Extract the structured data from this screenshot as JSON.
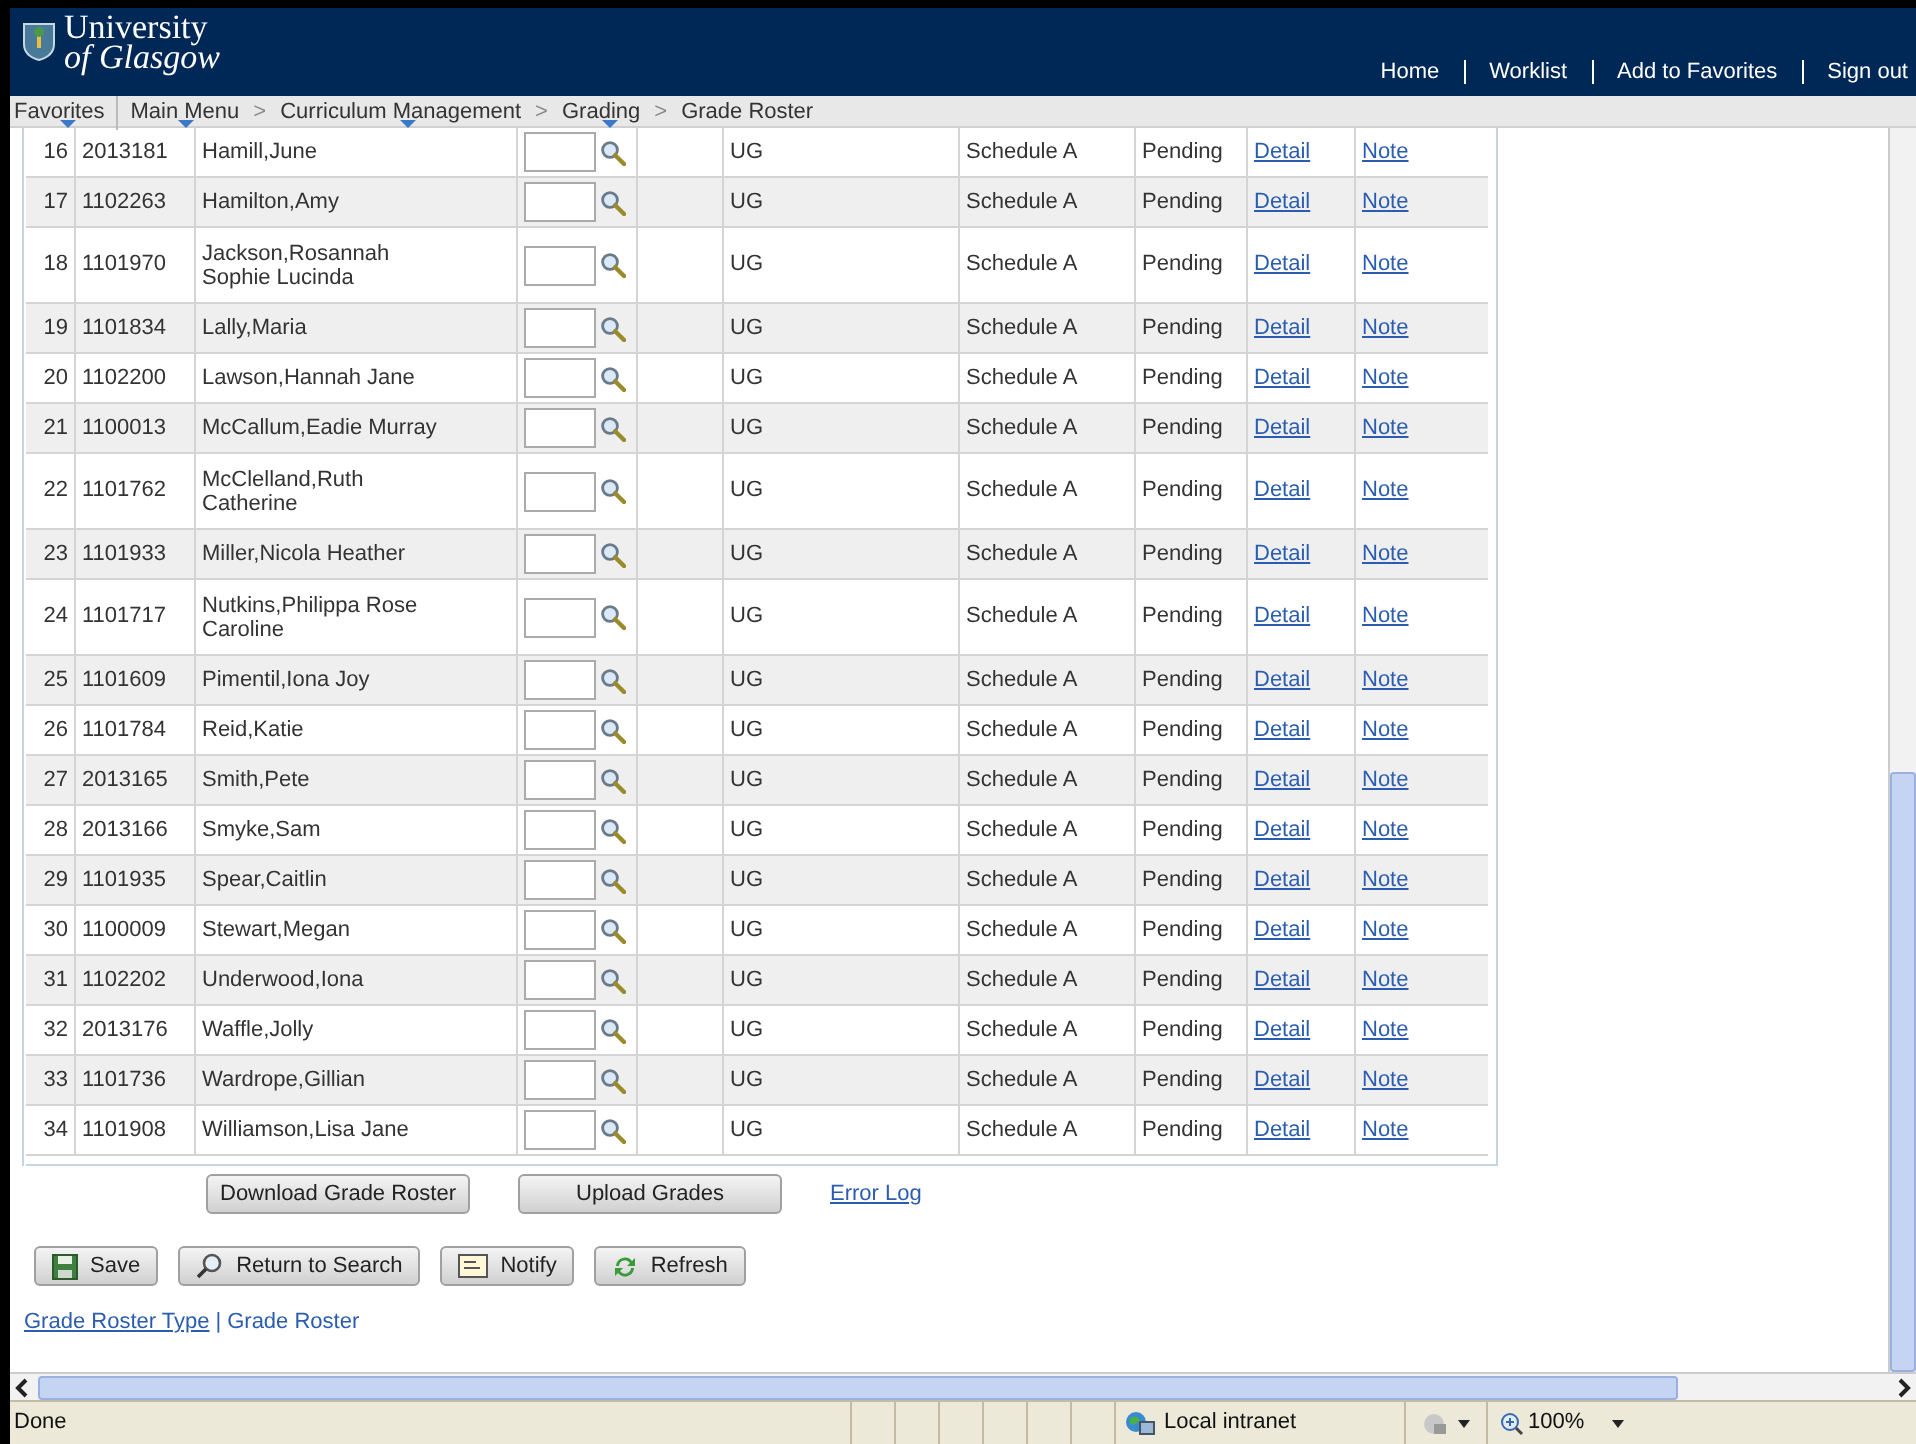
{
  "header": {
    "logo_line1": "University",
    "logo_line2": "of Glasgow",
    "nav": [
      "Home",
      "Worklist",
      "Add to Favorites",
      "Sign out"
    ]
  },
  "breadcrumb": [
    {
      "label": "Favorites",
      "menu": true,
      "kind": "item"
    },
    {
      "label": "Main Menu",
      "menu": true,
      "kind": "item"
    },
    {
      "label": ">",
      "kind": "sep"
    },
    {
      "label": "Curriculum Management",
      "menu": true,
      "kind": "item"
    },
    {
      "label": ">",
      "kind": "sep"
    },
    {
      "label": "Grading",
      "menu": true,
      "kind": "item"
    },
    {
      "label": ">",
      "kind": "sep"
    },
    {
      "label": "Grade Roster",
      "menu": false,
      "kind": "item"
    }
  ],
  "roster": {
    "rows": [
      {
        "num": "16",
        "id": "2013181",
        "name": "Hamill,June",
        "level": "UG",
        "schedule": "Schedule A",
        "status": "Pending",
        "detail": "Detail",
        "note": "Note"
      },
      {
        "num": "17",
        "id": "1102263",
        "name": "Hamilton,Amy",
        "level": "UG",
        "schedule": "Schedule A",
        "status": "Pending",
        "detail": "Detail",
        "note": "Note"
      },
      {
        "num": "18",
        "id": "1101970",
        "name": "Jackson,Rosannah\nSophie Lucinda",
        "level": "UG",
        "schedule": "Schedule A",
        "status": "Pending",
        "detail": "Detail",
        "note": "Note"
      },
      {
        "num": "19",
        "id": "1101834",
        "name": "Lally,Maria",
        "level": "UG",
        "schedule": "Schedule A",
        "status": "Pending",
        "detail": "Detail",
        "note": "Note"
      },
      {
        "num": "20",
        "id": "1102200",
        "name": "Lawson,Hannah Jane",
        "level": "UG",
        "schedule": "Schedule A",
        "status": "Pending",
        "detail": "Detail",
        "note": "Note"
      },
      {
        "num": "21",
        "id": "1100013",
        "name": "McCallum,Eadie Murray",
        "level": "UG",
        "schedule": "Schedule A",
        "status": "Pending",
        "detail": "Detail",
        "note": "Note"
      },
      {
        "num": "22",
        "id": "1101762",
        "name": "McClelland,Ruth\nCatherine",
        "level": "UG",
        "schedule": "Schedule A",
        "status": "Pending",
        "detail": "Detail",
        "note": "Note"
      },
      {
        "num": "23",
        "id": "1101933",
        "name": "Miller,Nicola Heather",
        "level": "UG",
        "schedule": "Schedule A",
        "status": "Pending",
        "detail": "Detail",
        "note": "Note"
      },
      {
        "num": "24",
        "id": "1101717",
        "name": "Nutkins,Philippa Rose\nCaroline",
        "level": "UG",
        "schedule": "Schedule A",
        "status": "Pending",
        "detail": "Detail",
        "note": "Note"
      },
      {
        "num": "25",
        "id": "1101609",
        "name": "Pimentil,Iona Joy",
        "level": "UG",
        "schedule": "Schedule A",
        "status": "Pending",
        "detail": "Detail",
        "note": "Note"
      },
      {
        "num": "26",
        "id": "1101784",
        "name": "Reid,Katie",
        "level": "UG",
        "schedule": "Schedule A",
        "status": "Pending",
        "detail": "Detail",
        "note": "Note"
      },
      {
        "num": "27",
        "id": "2013165",
        "name": "Smith,Pete",
        "level": "UG",
        "schedule": "Schedule A",
        "status": "Pending",
        "detail": "Detail",
        "note": "Note"
      },
      {
        "num": "28",
        "id": "2013166",
        "name": "Smyke,Sam",
        "level": "UG",
        "schedule": "Schedule A",
        "status": "Pending",
        "detail": "Detail",
        "note": "Note"
      },
      {
        "num": "29",
        "id": "1101935",
        "name": "Spear,Caitlin",
        "level": "UG",
        "schedule": "Schedule A",
        "status": "Pending",
        "detail": "Detail",
        "note": "Note"
      },
      {
        "num": "30",
        "id": "1100009",
        "name": "Stewart,Megan",
        "level": "UG",
        "schedule": "Schedule A",
        "status": "Pending",
        "detail": "Detail",
        "note": "Note"
      },
      {
        "num": "31",
        "id": "1102202",
        "name": "Underwood,Iona",
        "level": "UG",
        "schedule": "Schedule A",
        "status": "Pending",
        "detail": "Detail",
        "note": "Note"
      },
      {
        "num": "32",
        "id": "2013176",
        "name": "Waffle,Jolly",
        "level": "UG",
        "schedule": "Schedule A",
        "status": "Pending",
        "detail": "Detail",
        "note": "Note"
      },
      {
        "num": "33",
        "id": "1101736",
        "name": "Wardrope,Gillian",
        "level": "UG",
        "schedule": "Schedule A",
        "status": "Pending",
        "detail": "Detail",
        "note": "Note"
      },
      {
        "num": "34",
        "id": "1101908",
        "name": "Williamson,Lisa Jane",
        "level": "UG",
        "schedule": "Schedule A",
        "status": "Pending",
        "detail": "Detail",
        "note": "Note"
      }
    ]
  },
  "roster_actions": {
    "download": "Download Grade Roster",
    "upload": "Upload Grades",
    "error_log": "Error Log"
  },
  "toolbar": [
    {
      "label": "Save",
      "kind": "save"
    },
    {
      "label": "Return to Search",
      "kind": "search"
    },
    {
      "label": "Notify",
      "kind": "notify"
    },
    {
      "label": "Refresh",
      "kind": "refresh"
    }
  ],
  "page_links": [
    "Grade Roster Type",
    "Grade Roster"
  ],
  "page_links_separator": "|",
  "status_bar": {
    "text": "Done",
    "zone": "Local intranet",
    "zoom": "100%"
  }
}
